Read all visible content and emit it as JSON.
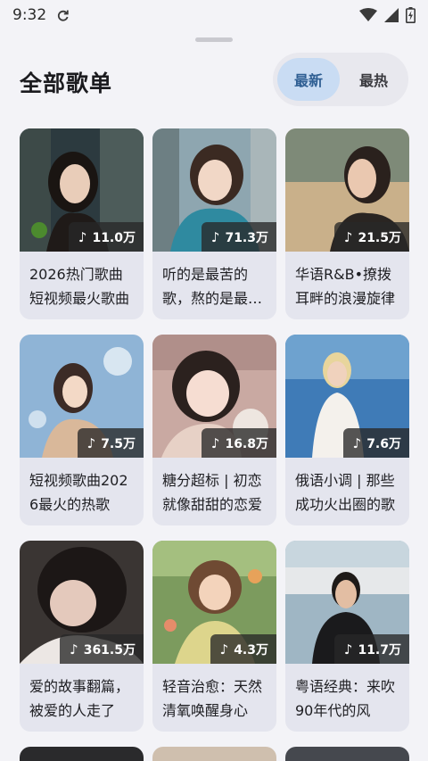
{
  "status": {
    "time": "9:32"
  },
  "header": {
    "title": "全部歌单"
  },
  "tabs": {
    "newest": "最新",
    "hottest": "最热"
  },
  "playlists": [
    {
      "plays": "11.0万",
      "title": "2026热门歌曲 短视频最火歌曲"
    },
    {
      "plays": "71.3万",
      "title": "听的是最苦的歌，熬的是最难的夜"
    },
    {
      "plays": "21.5万",
      "title": "华语R&B•撩拨耳畔的浪漫旋律"
    },
    {
      "plays": "7.5万",
      "title": "短视频歌曲2026最火的热歌"
    },
    {
      "plays": "16.8万",
      "title": "糖分超标 | 初恋就像甜甜的恋爱"
    },
    {
      "plays": "7.6万",
      "title": "俄语小调 | 那些成功火出圈的歌"
    },
    {
      "plays": "361.5万",
      "title": "爱的故事翻篇，被爱的人走了"
    },
    {
      "plays": "4.3万",
      "title": "轻音治愈：天然清氧唤醒身心"
    },
    {
      "plays": "11.7万",
      "title": "粤语经典：来吹90年代的风"
    }
  ]
}
